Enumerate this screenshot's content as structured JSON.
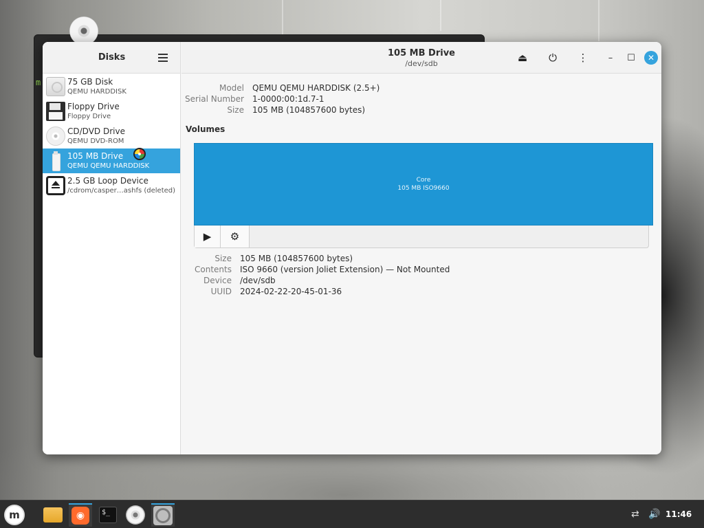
{
  "sidebar": {
    "title": "Disks",
    "items": [
      {
        "name": "75 GB Disk",
        "sub": "QEMU HARDDISK",
        "icon": "hard-disk-icon"
      },
      {
        "name": "Floppy Drive",
        "sub": "Floppy Drive",
        "icon": "floppy-icon"
      },
      {
        "name": "CD/DVD Drive",
        "sub": "QEMU DVD-ROM",
        "icon": "cd-drive-icon"
      },
      {
        "name": "105 MB Drive",
        "sub": "QEMU QEMU HARDDISK",
        "icon": "usb-drive-icon"
      },
      {
        "name": "2.5 GB Loop Device",
        "sub": "/cdrom/casper…ashfs (deleted)",
        "icon": "loop-device-icon"
      }
    ]
  },
  "header": {
    "title": "105 MB Drive",
    "subtitle": "/dev/sdb"
  },
  "drive_info": {
    "model_label": "Model",
    "model_value": "QEMU QEMU HARDDISK (2.5+)",
    "serial_label": "Serial Number",
    "serial_value": "1-0000:00:1d.7-1",
    "size_label": "Size",
    "size_value": "105 MB (104857600 bytes)"
  },
  "volumes": {
    "title": "Volumes",
    "partition_name": "Core",
    "partition_desc": "105 MB ISO9660"
  },
  "volume_info": {
    "size_label": "Size",
    "size_value": "105 MB (104857600 bytes)",
    "contents_label": "Contents",
    "contents_value": "ISO 9660 (version Joliet Extension) — Not Mounted",
    "device_label": "Device",
    "device_value": "/dev/sdb",
    "uuid_label": "UUID",
    "uuid_value": "2024-02-22-20-45-01-36"
  },
  "background_terminal": {
    "text": "m:"
  },
  "taskbar": {
    "mint_glyph": "m",
    "terminal_glyph": "$_",
    "clock": "11:46"
  },
  "colors": {
    "accent": "#35a3dd",
    "partition": "#1e96d5",
    "taskbar": "#2d2d2d"
  }
}
